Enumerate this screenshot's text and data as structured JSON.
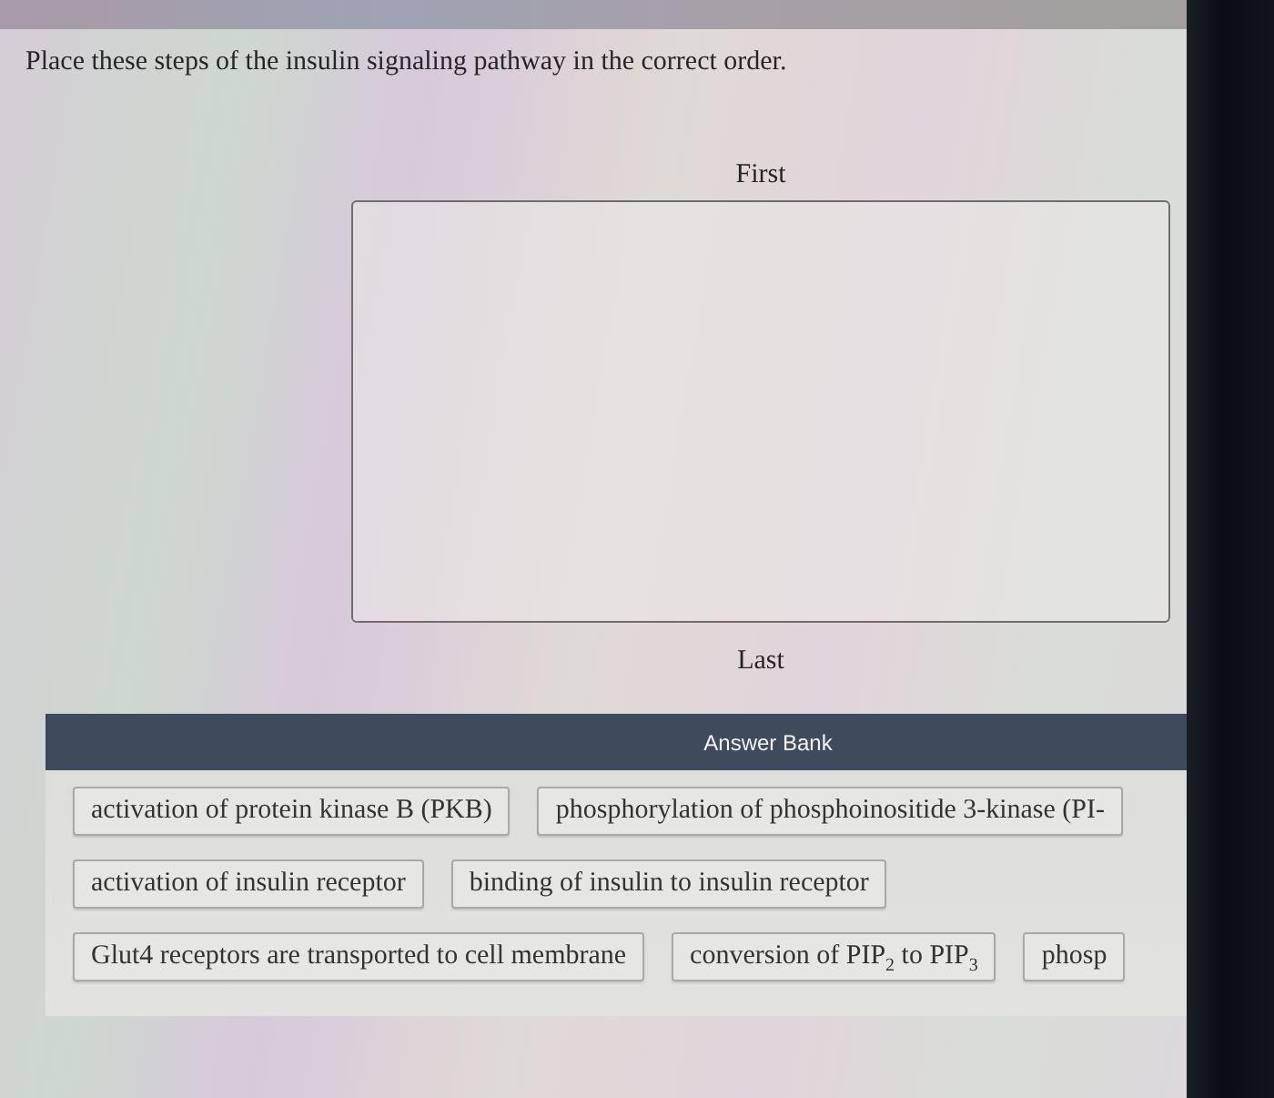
{
  "prompt": "Place these steps of the insulin signaling pathway in the correct order.",
  "sorting_box": {
    "top_label": "First",
    "bottom_label": "Last"
  },
  "answer_bank": {
    "title": "Answer Bank",
    "rows": [
      {
        "items": [
          "activation of protein kinase B (PKB)",
          "phosphorylation of phosphoinositide 3-kinase (PI-"
        ]
      },
      {
        "items": [
          "activation of insulin receptor",
          "binding of insulin to insulin receptor"
        ]
      },
      {
        "items": [
          "Glut4 receptors are transported to cell membrane",
          "conversion of PIP$_{2}$ to PIP$_{3}$",
          "phosp"
        ]
      }
    ]
  }
}
